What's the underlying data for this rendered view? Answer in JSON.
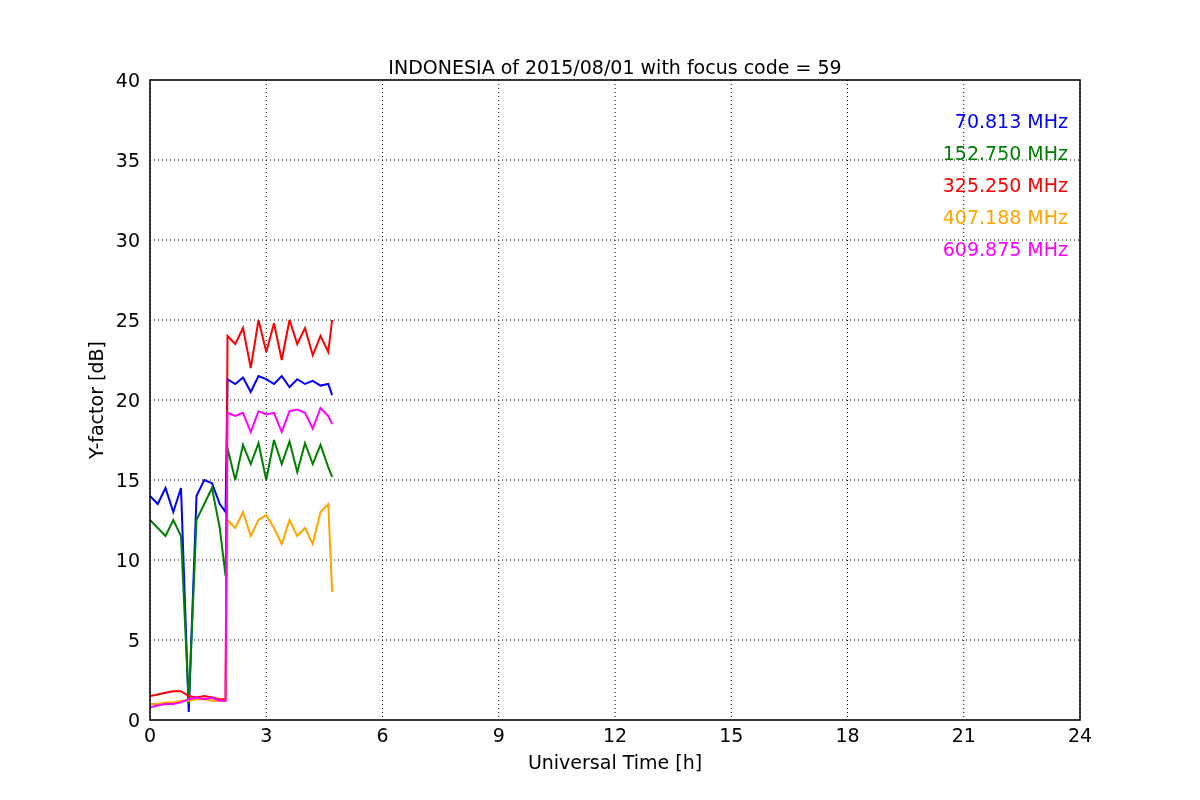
{
  "figure": {
    "chart_data": {
      "type": "line",
      "title": "INDONESIA of 2015/08/01 with focus code = 59",
      "xlabel": "Universal Time [h]",
      "ylabel": "Y-factor [dB]",
      "xlim": [
        0,
        24
      ],
      "ylim": [
        0,
        40
      ],
      "xticks": [
        0,
        3,
        6,
        9,
        12,
        15,
        18,
        21,
        24
      ],
      "yticks": [
        0,
        5,
        10,
        15,
        20,
        25,
        30,
        35,
        40
      ],
      "grid": true,
      "x": [
        0,
        0.2,
        0.4,
        0.6,
        0.8,
        1.0,
        1.2,
        1.4,
        1.6,
        1.8,
        1.95,
        2.0,
        2.2,
        2.4,
        2.6,
        2.8,
        3.0,
        3.2,
        3.4,
        3.6,
        3.8,
        4.0,
        4.2,
        4.4,
        4.6,
        4.7
      ],
      "series": [
        {
          "name": "70.813 MHz",
          "color": "#0000ff",
          "values": [
            14,
            13.5,
            14.5,
            13,
            14.5,
            0.5,
            14,
            15,
            14.8,
            13.5,
            13,
            21.3,
            21,
            21.4,
            20.5,
            21.5,
            21.3,
            21,
            21.5,
            20.8,
            21.3,
            21,
            21.2,
            20.9,
            21,
            20.3
          ]
        },
        {
          "name": "152.750 MHz",
          "color": "#008000",
          "values": [
            12.5,
            12,
            11.5,
            12.5,
            11.5,
            1,
            12.5,
            13.5,
            14.5,
            12,
            9,
            17,
            15,
            17.2,
            16,
            17.3,
            15,
            17.5,
            16,
            17.4,
            15.5,
            17.3,
            16,
            17.2,
            15.8,
            15.2
          ]
        },
        {
          "name": "325.250 MHz",
          "color": "#ff0000",
          "values": [
            1.5,
            1.6,
            1.7,
            1.8,
            1.8,
            1.5,
            1.4,
            1.5,
            1.4,
            1.3,
            1.3,
            24,
            23.5,
            24.5,
            22,
            25,
            23,
            24.8,
            22.5,
            25,
            23.5,
            24.5,
            22.8,
            24,
            23,
            25
          ]
        },
        {
          "name": "407.188 MHz",
          "color": "#ffa500",
          "values": [
            1,
            1,
            1.1,
            1.1,
            1.2,
            1.2,
            1.3,
            1.3,
            1.2,
            1.2,
            1.2,
            12.5,
            12,
            13,
            11.5,
            12.5,
            12.8,
            12,
            11,
            12.5,
            11.5,
            12,
            11,
            13,
            13.5,
            8
          ]
        },
        {
          "name": "609.875 MHz",
          "color": "#ff00ff",
          "values": [
            0.8,
            0.9,
            1,
            1,
            1.1,
            1.3,
            1.4,
            1.3,
            1.4,
            1.2,
            1.2,
            19.2,
            19,
            19.2,
            18,
            19.3,
            19.1,
            19.2,
            18,
            19.3,
            19.4,
            19.2,
            18.2,
            19.5,
            19,
            18.5
          ]
        }
      ]
    }
  }
}
